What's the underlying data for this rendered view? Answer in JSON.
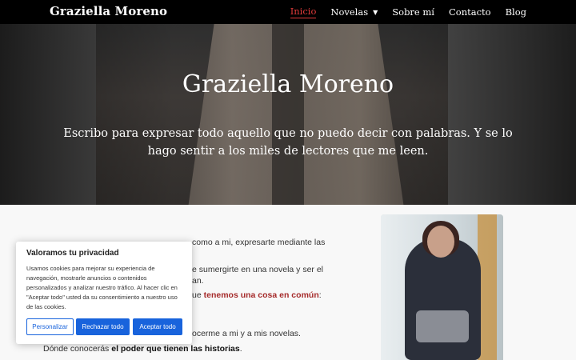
{
  "header": {
    "brand": "Graziella Moreno",
    "nav": [
      {
        "label": "Inicio",
        "active": true
      },
      {
        "label": "Novelas",
        "has_dropdown": true
      },
      {
        "label": "Sobre mí"
      },
      {
        "label": "Contacto"
      },
      {
        "label": "Blog"
      }
    ]
  },
  "hero": {
    "title": "Graziella Moreno",
    "subtitle": "Escribo para expresar todo aquello que no puedo decir con palabras. Y se lo hago sentir a los miles de lectores que me leen."
  },
  "content": {
    "line1": "como a mi, expresarte mediante las",
    "line2": "e sumergirte en una novela y ser el",
    "line3": "an.",
    "line4_prefix": "ue ",
    "line4_highlight": "tenemos una cosa en común",
    "line4_suffix": ":",
    "line5": "ocerme a mi y a mis novelas.",
    "line6_prefix": "Dónde conocerás ",
    "line6_bold": "el poder que tienen las historias",
    "line6_suffix": "."
  },
  "cookie": {
    "title": "Valoramos tu privacidad",
    "text": "Usamos cookies para mejorar su experiencia de navegación, mostrarle anuncios o contenidos personalizados y analizar nuestro tráfico. Al hacer clic en \"Aceptar todo\" usted da su consentimiento a nuestro uso de las cookies.",
    "btn_customize": "Personalizar",
    "btn_reject": "Rechazar todo",
    "btn_accept": "Aceptar todo"
  },
  "colors": {
    "accent": "#e33b3b",
    "cookie_blue": "#1863dc",
    "highlight": "#a52a2a"
  },
  "icons": {
    "nav_dropdown": "caret-down-icon"
  }
}
